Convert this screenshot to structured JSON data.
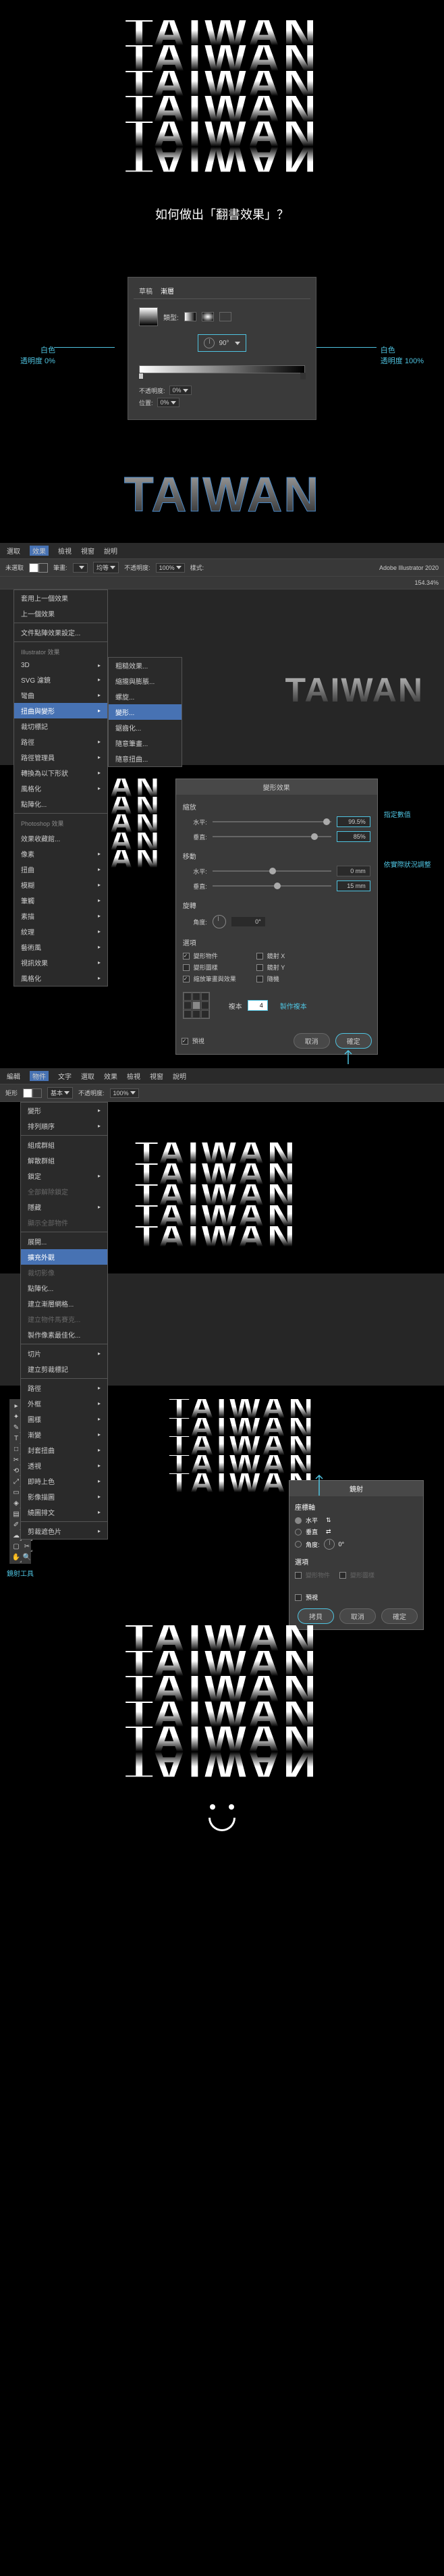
{
  "hero_word": "TAIWAN",
  "question": "如何做出「翻書效果」？",
  "gradient_panel": {
    "tabs": [
      "草稿",
      "漸層"
    ],
    "type_label": "類型:",
    "angle_value": "90°",
    "opacity_label": "不透明度:",
    "opacity_value": "0%",
    "position_label": "位置:",
    "position_value": "0%"
  },
  "annotations": {
    "left_color": "白色",
    "left_opacity": "透明度 0%",
    "right_color": "白色",
    "right_opacity": "透明度 100%"
  },
  "menubar": [
    "選取",
    "效果",
    "檢視",
    "視窗",
    "說明"
  ],
  "toolbar": {
    "no_selection": "未選取",
    "stroke_label": "筆畫:",
    "uniform": "均等",
    "opacity_label": "不透明度:",
    "opacity_value": "100%",
    "style_label": "樣式:",
    "app_name": "Adobe Illustrator 2020",
    "zoom": "154.34%"
  },
  "effects_menu": {
    "apply_last": "套用上一個效果",
    "last_effect": "上一個效果",
    "doc_raster": "文件點陣效果設定...",
    "illustrator_header": "Illustrator 效果",
    "items_top": [
      "3D",
      "SVG 濾鏡",
      "彎曲"
    ],
    "distort": "扭曲與變形",
    "items_mid": [
      "裁切標記",
      "路徑",
      "路徑管理員",
      "轉換為以下形狀",
      "風格化",
      "點陣化..."
    ],
    "photoshop_header": "Photoshop 效果",
    "ps_items": [
      "效果收藏館...",
      "像素",
      "扭曲",
      "模糊",
      "筆觸",
      "素描",
      "紋理",
      "藝術風",
      "視訊效果",
      "風格化"
    ],
    "submenu": [
      "粗糙效果...",
      "縮攏與膨脹...",
      "螺旋...",
      "變形...",
      "鋸齒化...",
      "隨意筆畫...",
      "隨意扭曲..."
    ]
  },
  "transform_dialog": {
    "title": "變形效果",
    "scale_header": "縮放",
    "horizontal": "水平:",
    "vertical": "垂直:",
    "h_value": "99.5%",
    "v_value": "85%",
    "move_header": "移動",
    "move_h": "0 mm",
    "move_v": "15 mm",
    "rotate_header": "旋轉",
    "angle_label": "角度:",
    "angle_value": "0°",
    "options_header": "選項",
    "cb_transform_obj": "變形物件",
    "cb_transform_pattern": "變形圖樣",
    "cb_scale_stroke": "縮放筆畫與效果",
    "cb_mirror_x": "鏡射 X",
    "cb_mirror_y": "鏡射 Y",
    "cb_random": "隨機",
    "copies_label": "複本",
    "copies_value": "4",
    "preview": "預視",
    "cancel": "取消",
    "ok": "確定",
    "note_scale": "指定數值",
    "note_move": "依實際狀況調整",
    "note_copies": "製作複本"
  },
  "menubar2": [
    "編輯",
    "物件",
    "文字",
    "選取",
    "效果",
    "檢視",
    "視窗",
    "說明"
  ],
  "toolbar2": {
    "rect_tool": "矩形",
    "basic": "基本",
    "opacity_label": "不透明度:",
    "opacity_value": "100%"
  },
  "object_menu": {
    "transform": "變形",
    "arrange": "排列順序",
    "group": "組成群組",
    "ungroup": "解散群組",
    "lock": "鎖定",
    "unlock_all": "全部解除鎖定",
    "hide": "隱藏",
    "show_all": "顯示全部物件",
    "expand": "展開...",
    "expand_appearance": "擴充外觀",
    "crop_image": "裁切影像",
    "rasterize": "點陣化...",
    "gradient_mesh": "建立漸層網格...",
    "object_mosaic": "建立物件馬賽克...",
    "flatten": "製作像素最佳化...",
    "slice": "切片",
    "trim_marks": "建立剪裁標記",
    "path": "路徑",
    "shape": "外框",
    "pattern": "圖樣",
    "blend": "漸變",
    "envelope": "封套扭曲",
    "perspective": "透視",
    "live_paint": "即時上色",
    "image_trace": "影像描圖",
    "text_wrap": "繞圖排文",
    "clipping_mask": "剪裁遮色片"
  },
  "shear_tool_label": "鏡射工具",
  "shear_dialog": {
    "title": "鏡射",
    "axis_header": "座標軸",
    "horizontal": "水平",
    "vertical": "垂直",
    "angle_label": "角度:",
    "angle_value": "0°",
    "options_header": "選項",
    "transform_obj": "變形物件",
    "transform_pattern": "變形圖樣",
    "preview": "預視",
    "copy": "拷貝",
    "cancel": "取消",
    "ok": "確定"
  }
}
